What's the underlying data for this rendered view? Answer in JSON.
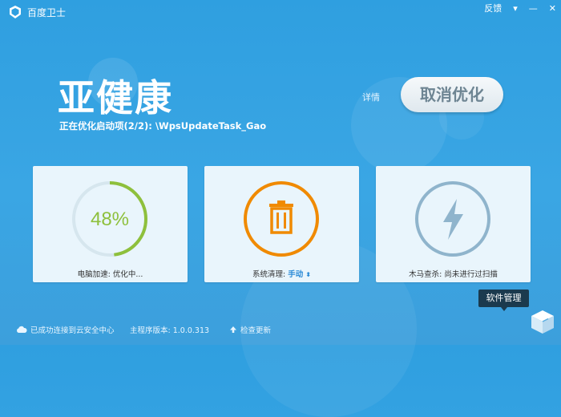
{
  "window": {
    "title": "百度卫士",
    "feedback_label": "反馈",
    "menu_label": "▾",
    "minimize_label": "—",
    "close_label": "✕"
  },
  "status": {
    "title": "亚健康",
    "subtitle": "正在优化启动项(2/2): \\WpsUpdateTask_Gao",
    "detail_link": "详情",
    "cancel_button": "取消优化"
  },
  "cards": {
    "speed": {
      "percent_text": "48%",
      "progress": 0.48,
      "label": "电脑加速: 优化中..."
    },
    "clean": {
      "label": "系统清理:",
      "mode": "手动",
      "mode_arrow": "⬍"
    },
    "trojan": {
      "label": "木马查杀: 尚未进行过扫描"
    }
  },
  "tooltip": {
    "text": "软件管理"
  },
  "footer": {
    "cloud_status": "已成功连接到云安全中心",
    "version": "主程序版本: 1.0.0.313",
    "update_link": "检查更新"
  },
  "colors": {
    "progress_green": "#8ec03c",
    "clean_orange": "#f08a00",
    "trojan_blue": "#8fb4cc"
  }
}
